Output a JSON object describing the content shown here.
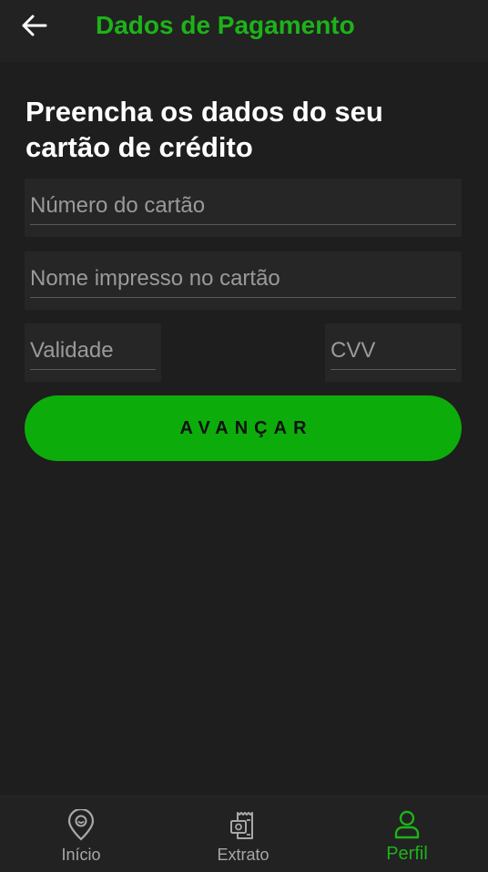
{
  "header": {
    "title": "Dados de Pagamento",
    "back_icon": "arrow-left-icon"
  },
  "form": {
    "headline": "Preencha os dados do seu cartão de crédito",
    "card_number_placeholder": "Número do cartão",
    "card_name_placeholder": "Nome impresso no cartão",
    "expiry_placeholder": "Validade",
    "cvv_placeholder": "CVV",
    "submit_label": "AVANÇAR"
  },
  "bottom_nav": {
    "items": [
      {
        "label": "Início",
        "icon": "location-pin-icon",
        "active": false
      },
      {
        "label": "Extrato",
        "icon": "receipt-icon",
        "active": false
      },
      {
        "label": "Perfil",
        "icon": "user-icon",
        "active": true
      }
    ]
  },
  "colors": {
    "accent": "#1cb319",
    "button": "#0cad0a",
    "background": "#1e1e1e",
    "bar": "#222222"
  }
}
